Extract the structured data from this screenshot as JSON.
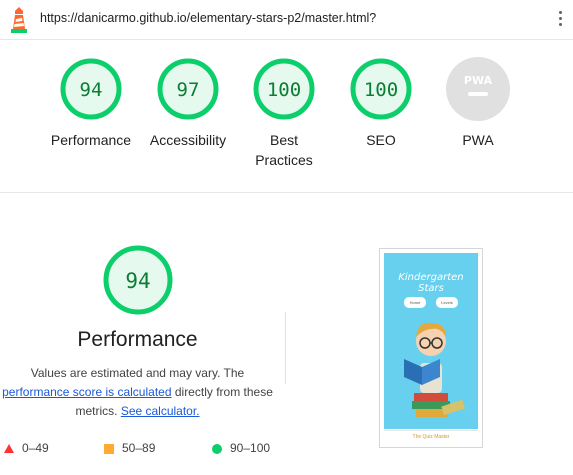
{
  "header": {
    "url": "https://danicarmo.github.io/elementary-stars-p2/master.html?",
    "logo_icon": "lighthouse-icon",
    "menu_icon": "kebab-menu-icon"
  },
  "gauges": [
    {
      "score": "94",
      "label": "Performance"
    },
    {
      "score": "97",
      "label": "Accessibility"
    },
    {
      "score": "100",
      "label": "Best Practices"
    },
    {
      "score": "100",
      "label": "SEO"
    },
    {
      "score": "PWA",
      "label": "PWA"
    }
  ],
  "performance": {
    "score": "94",
    "title": "Performance",
    "desc_1": "Values are estimated and may vary. The",
    "desc_link_1": "performance score is calculated",
    "desc_2": " directly from these",
    "desc_3": "metrics. ",
    "desc_link_2": "See calculator."
  },
  "legend": [
    {
      "range": "0–49",
      "shape": "triangle",
      "color": "#ff3333"
    },
    {
      "range": "50–89",
      "shape": "square",
      "color": "#ffaa33"
    },
    {
      "range": "90–100",
      "shape": "circle",
      "color": "#0cce6b"
    }
  ],
  "thumbnail": {
    "title": "Kindergarten Stars",
    "btn_home": "Home",
    "btn_levels": "Levels",
    "footer": "The Quiz Master"
  },
  "colors": {
    "pass": "#0cce6b",
    "pass_text": "#0c7d33",
    "pass_bg": "#e5f9ee",
    "na": "#e0e0e0"
  }
}
